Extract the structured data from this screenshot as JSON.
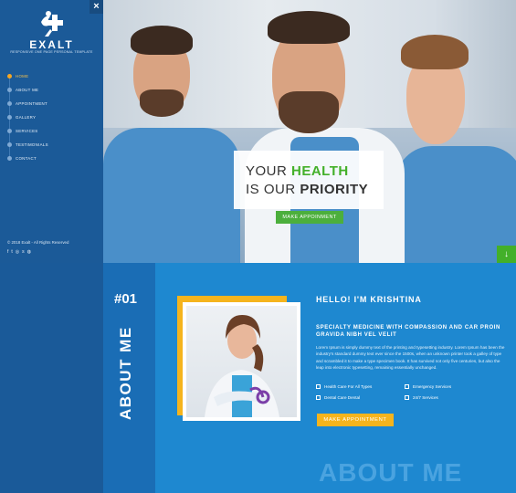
{
  "brand": {
    "name": "EXALT",
    "tagline": "RESPONSIVE ONE PAGE PERSONAL TEMPLATE"
  },
  "sidebar": {
    "close_label": "×",
    "items": [
      {
        "label": "HOME",
        "active": true
      },
      {
        "label": "ABOUT ME",
        "active": false
      },
      {
        "label": "APPOINTMENT",
        "active": false
      },
      {
        "label": "GALLERY",
        "active": false
      },
      {
        "label": "SERVICES",
        "active": false
      },
      {
        "label": "TESTIMONIALS",
        "active": false
      },
      {
        "label": "CONTACT",
        "active": false
      }
    ],
    "copyright": "© 2018 Exalt - All Rights Reserved",
    "social_icons": [
      "facebook-icon",
      "twitter-icon",
      "instagram-icon",
      "skype-icon",
      "dribbble-icon"
    ]
  },
  "hero": {
    "line1_prefix": "YOUR ",
    "line1_accent": "HEALTH",
    "line2_prefix": "IS OUR ",
    "line2_strong": "PRIORITY",
    "button_label": "MAKE APPOINMENT",
    "down_arrow": "↓"
  },
  "about": {
    "number": "#01",
    "vertical_title": "ABOUT ME",
    "hello": "HELLO! I'M KRISHTINA",
    "specialty": "SPECIALTY MEDICINE WITH COMPASSION AND CAR PROIN GRAVIDA NIBH VEL VELIT",
    "lorem": "Lorem Ipsum is simply dummy text of the printing and typesetting industry. Lorem Ipsum has been the industry's standard dummy text ever since the 1500s, when an unknown printer took a galley of type and scrambled it to make a type specimen book. It has survived not only five centuries, but also the leap into electronic typesetting, remaining essentially unchanged.",
    "features": [
      "Health Care For All Types",
      "Emergency Services",
      "Dental Care Dental",
      "24/7 Services"
    ],
    "button_label": "MAKE APPOINTMENT",
    "watermark": "ABOUT ME"
  },
  "colors": {
    "accent_green": "#43b02a",
    "accent_yellow": "#f5b41d",
    "sidebar_blue": "#1b5a98",
    "section_blue": "#1e88d0"
  }
}
